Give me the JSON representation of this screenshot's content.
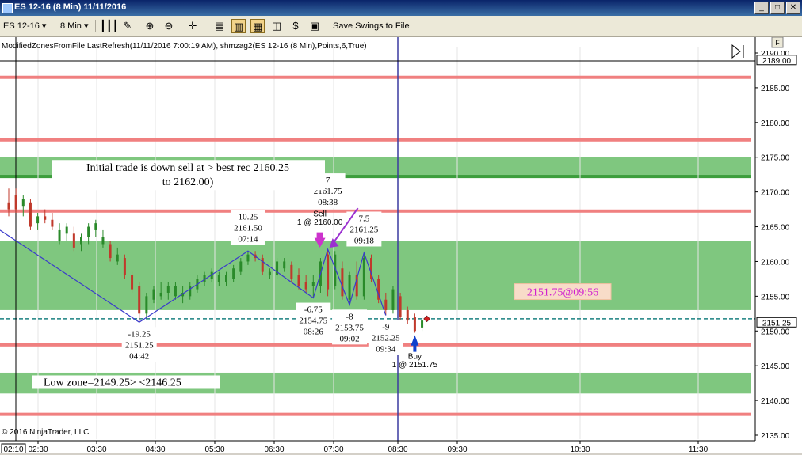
{
  "window": {
    "title": "ES 12-16 (8 Min)  11/11/2016"
  },
  "toolbar": {
    "instrument": "ES 12-16",
    "interval": "8 Min",
    "save_swings_label": "Save Swings to File"
  },
  "colors": {
    "up_bar": "#2a8a2a",
    "down_bar": "#c0392b",
    "neutral_bar": "#8b5a2b",
    "zone_red": "#f08080",
    "zone_green_light": "#7fc77f",
    "zone_green_dark": "#3c9e3c",
    "swing_line": "#3a3acc",
    "current_price_line": "#1a8080",
    "sell_arrow": "#cc33cc",
    "buy_arrow": "#1040cc"
  },
  "chart_data": {
    "type": "candlestick",
    "indicator_label": "ModifiedZonesFromFile LastRefresh(11/11/2016 7:00:19 AM), shmzag2(ES 12-16 (8 Min),Points,6,True)",
    "copyright": "© 2016 NinjaTrader, LLC",
    "y_range": [
      2134,
      2191
    ],
    "y_ticks": [
      "2135.00",
      "2140.00",
      "2145.00",
      "2150.00",
      "2155.00",
      "2160.00",
      "2165.00",
      "2170.00",
      "2175.00",
      "2180.00",
      "2185.00",
      "2190.00"
    ],
    "x_ticks": [
      "02:30",
      "03:30",
      "04:30",
      "05:30",
      "06:30",
      "07:30",
      "08:30",
      "09:30",
      "10:30",
      "11:30"
    ],
    "crosshair_time": "02:10",
    "price_tags": [
      "2189.00",
      "2151.25"
    ],
    "current_price": 2151.75,
    "red_lines": [
      2186.5,
      2177.5,
      2167.25,
      2148.0,
      2138.0
    ],
    "green_zones": [
      {
        "low": 2153.0,
        "high": 2163.0,
        "shade": "light"
      },
      {
        "low": 2172.0,
        "high": 2175.0,
        "shade": "light",
        "base_dark": true
      },
      {
        "low": 2141.0,
        "high": 2144.0,
        "shade": "light"
      }
    ],
    "bars": [
      {
        "o": 2167.5,
        "h": 2170.5,
        "l": 2166.5,
        "c": 2168.5,
        "d": "down"
      },
      {
        "o": 2169.5,
        "h": 2170.5,
        "l": 2167.0,
        "c": 2167.5,
        "d": "down"
      },
      {
        "o": 2168.0,
        "h": 2169.5,
        "l": 2166.5,
        "c": 2169.0,
        "d": "up"
      },
      {
        "o": 2168.5,
        "h": 2169.0,
        "l": 2164.5,
        "c": 2165.0,
        "d": "down"
      },
      {
        "o": 2165.5,
        "h": 2167.0,
        "l": 2164.5,
        "c": 2166.5,
        "d": "up"
      },
      {
        "o": 2166.5,
        "h": 2167.5,
        "l": 2165.5,
        "c": 2166.0,
        "d": "down"
      },
      {
        "o": 2166.0,
        "h": 2167.0,
        "l": 2164.5,
        "c": 2165.0,
        "d": "down"
      },
      {
        "o": 2164.5,
        "h": 2165.5,
        "l": 2162.5,
        "c": 2163.0,
        "d": "up"
      },
      {
        "o": 2164.0,
        "h": 2165.5,
        "l": 2163.0,
        "c": 2165.0,
        "d": "up"
      },
      {
        "o": 2164.0,
        "h": 2165.0,
        "l": 2161.5,
        "c": 2162.0,
        "d": "down"
      },
      {
        "o": 2162.5,
        "h": 2164.0,
        "l": 2161.5,
        "c": 2163.5,
        "d": "up"
      },
      {
        "o": 2163.5,
        "h": 2165.5,
        "l": 2162.5,
        "c": 2165.0,
        "d": "up"
      },
      {
        "o": 2164.5,
        "h": 2166.0,
        "l": 2163.5,
        "c": 2165.5,
        "d": "up"
      },
      {
        "o": 2163.5,
        "h": 2164.5,
        "l": 2162.0,
        "c": 2162.5,
        "d": "up"
      },
      {
        "o": 2162.5,
        "h": 2163.0,
        "l": 2160.0,
        "c": 2160.5,
        "d": "down"
      },
      {
        "o": 2161.0,
        "h": 2162.0,
        "l": 2159.5,
        "c": 2160.0,
        "d": "up"
      },
      {
        "o": 2160.5,
        "h": 2161.0,
        "l": 2157.5,
        "c": 2158.0,
        "d": "down"
      },
      {
        "o": 2158.0,
        "h": 2158.5,
        "l": 2155.5,
        "c": 2156.0,
        "d": "down"
      },
      {
        "o": 2156.5,
        "h": 2157.0,
        "l": 2151.25,
        "c": 2152.5,
        "d": "down"
      },
      {
        "o": 2152.5,
        "h": 2155.5,
        "l": 2152.0,
        "c": 2155.0,
        "d": "up"
      },
      {
        "o": 2154.5,
        "h": 2156.5,
        "l": 2154.0,
        "c": 2156.0,
        "d": "up"
      },
      {
        "o": 2155.0,
        "h": 2157.0,
        "l": 2154.5,
        "c": 2155.5,
        "d": "up"
      },
      {
        "o": 2155.5,
        "h": 2157.0,
        "l": 2154.5,
        "c": 2156.5,
        "d": "up"
      },
      {
        "o": 2156.5,
        "h": 2157.0,
        "l": 2154.5,
        "c": 2155.0,
        "d": "up"
      },
      {
        "o": 2155.5,
        "h": 2156.5,
        "l": 2154.0,
        "c": 2155.0,
        "d": "up"
      },
      {
        "o": 2155.0,
        "h": 2157.0,
        "l": 2154.5,
        "c": 2156.5,
        "d": "up"
      },
      {
        "o": 2156.0,
        "h": 2158.0,
        "l": 2155.5,
        "c": 2157.5,
        "d": "up"
      },
      {
        "o": 2157.0,
        "h": 2158.5,
        "l": 2156.5,
        "c": 2158.0,
        "d": "up"
      },
      {
        "o": 2157.5,
        "h": 2159.0,
        "l": 2157.0,
        "c": 2158.5,
        "d": "up"
      },
      {
        "o": 2158.0,
        "h": 2158.5,
        "l": 2156.5,
        "c": 2157.0,
        "d": "up"
      },
      {
        "o": 2157.0,
        "h": 2158.5,
        "l": 2156.5,
        "c": 2158.0,
        "d": "up"
      },
      {
        "o": 2157.5,
        "h": 2159.5,
        "l": 2157.0,
        "c": 2159.0,
        "d": "up"
      },
      {
        "o": 2158.5,
        "h": 2160.5,
        "l": 2158.0,
        "c": 2160.0,
        "d": "up"
      },
      {
        "o": 2160.0,
        "h": 2161.5,
        "l": 2159.5,
        "c": 2161.0,
        "d": "up"
      },
      {
        "o": 2161.0,
        "h": 2161.5,
        "l": 2160.0,
        "c": 2160.5,
        "d": "down"
      },
      {
        "o": 2160.5,
        "h": 2161.0,
        "l": 2158.0,
        "c": 2158.5,
        "d": "down"
      },
      {
        "o": 2158.5,
        "h": 2159.0,
        "l": 2157.5,
        "c": 2158.0,
        "d": "up"
      },
      {
        "o": 2158.0,
        "h": 2160.5,
        "l": 2157.5,
        "c": 2160.0,
        "d": "up"
      },
      {
        "o": 2160.0,
        "h": 2160.5,
        "l": 2158.5,
        "c": 2159.0,
        "d": "up"
      },
      {
        "o": 2159.5,
        "h": 2160.0,
        "l": 2157.0,
        "c": 2157.5,
        "d": "down"
      },
      {
        "o": 2158.0,
        "h": 2159.0,
        "l": 2156.0,
        "c": 2156.5,
        "d": "down"
      },
      {
        "o": 2157.0,
        "h": 2158.0,
        "l": 2155.5,
        "c": 2156.0,
        "d": "down"
      },
      {
        "o": 2156.5,
        "h": 2158.0,
        "l": 2154.75,
        "c": 2157.0,
        "d": "up"
      },
      {
        "o": 2156.5,
        "h": 2160.5,
        "l": 2155.5,
        "c": 2160.0,
        "d": "up"
      },
      {
        "o": 2161.0,
        "h": 2161.75,
        "l": 2155.0,
        "c": 2156.0,
        "d": "down"
      },
      {
        "o": 2156.5,
        "h": 2161.5,
        "l": 2156.0,
        "c": 2161.0,
        "d": "up"
      },
      {
        "o": 2159.0,
        "h": 2160.0,
        "l": 2154.5,
        "c": 2155.0,
        "d": "down"
      },
      {
        "o": 2154.5,
        "h": 2158.5,
        "l": 2153.75,
        "c": 2158.0,
        "d": "up"
      },
      {
        "o": 2158.0,
        "h": 2160.0,
        "l": 2154.5,
        "c": 2155.0,
        "d": "down"
      },
      {
        "o": 2155.0,
        "h": 2161.25,
        "l": 2154.5,
        "c": 2160.5,
        "d": "up"
      },
      {
        "o": 2160.5,
        "h": 2161.0,
        "l": 2157.0,
        "c": 2157.5,
        "d": "down"
      },
      {
        "o": 2157.5,
        "h": 2158.0,
        "l": 2154.0,
        "c": 2154.5,
        "d": "down"
      },
      {
        "o": 2154.5,
        "h": 2155.5,
        "l": 2152.25,
        "c": 2153.0,
        "d": "down"
      },
      {
        "o": 2153.0,
        "h": 2156.5,
        "l": 2152.5,
        "c": 2156.0,
        "d": "up"
      },
      {
        "o": 2155.0,
        "h": 2155.5,
        "l": 2151.5,
        "c": 2152.0,
        "d": "down"
      },
      {
        "o": 2153.0,
        "h": 2153.5,
        "l": 2151.0,
        "c": 2151.5,
        "d": "down"
      },
      {
        "o": 2152.0,
        "h": 2152.5,
        "l": 2149.75,
        "c": 2150.0,
        "d": "down"
      },
      {
        "o": 2150.5,
        "h": 2152.0,
        "l": 2150.0,
        "c": 2151.5,
        "d": "up"
      }
    ],
    "swings": [
      {
        "i": 0,
        "p": 2164.5,
        "off": true
      },
      {
        "i": 18,
        "p": 2151.25
      },
      {
        "i": 33,
        "p": 2161.5
      },
      {
        "i": 42,
        "p": 2154.75
      },
      {
        "i": 44,
        "p": 2161.75
      },
      {
        "i": 47,
        "p": 2153.75
      },
      {
        "i": 49,
        "p": 2161.25
      },
      {
        "i": 52,
        "p": 2152.25
      }
    ],
    "swing_labels": [
      {
        "i": 18,
        "lines": [
          "-19.25",
          "2151.25",
          "04:42"
        ],
        "pos": "below"
      },
      {
        "i": 33,
        "lines": [
          "10.25",
          "2161.50",
          "07:14"
        ],
        "pos": "above"
      },
      {
        "i": 42,
        "lines": [
          "-6.75",
          "2154.75",
          "08:26"
        ],
        "pos": "below"
      },
      {
        "i": 44,
        "lines": [
          "7",
          "2161.75",
          "08:38"
        ],
        "pos": "aboveHigh"
      },
      {
        "i": 47,
        "lines": [
          "-8",
          "2153.75",
          "09:02"
        ],
        "pos": "below"
      },
      {
        "i": 49,
        "lines": [
          "7.5",
          "2161.25",
          "09:18"
        ],
        "pos": "above"
      },
      {
        "i": 52,
        "lines": [
          "-9",
          "2152.25",
          "09:34"
        ],
        "pos": "below"
      }
    ],
    "annotations": {
      "initial_trade": [
        "Initial trade is down sell at > best rec 2160.25",
        "to 2162.00)"
      ],
      "low_zone": "Low  zone=2149.25>  <2146.25",
      "current_box": "2151.75@09:56"
    },
    "trades": {
      "sell": {
        "i": 44,
        "label": "Sell",
        "detail": "1 @ 2160.00"
      },
      "buy": {
        "i": 56,
        "label": "Buy",
        "detail": "1 @ 2151.75"
      }
    }
  }
}
